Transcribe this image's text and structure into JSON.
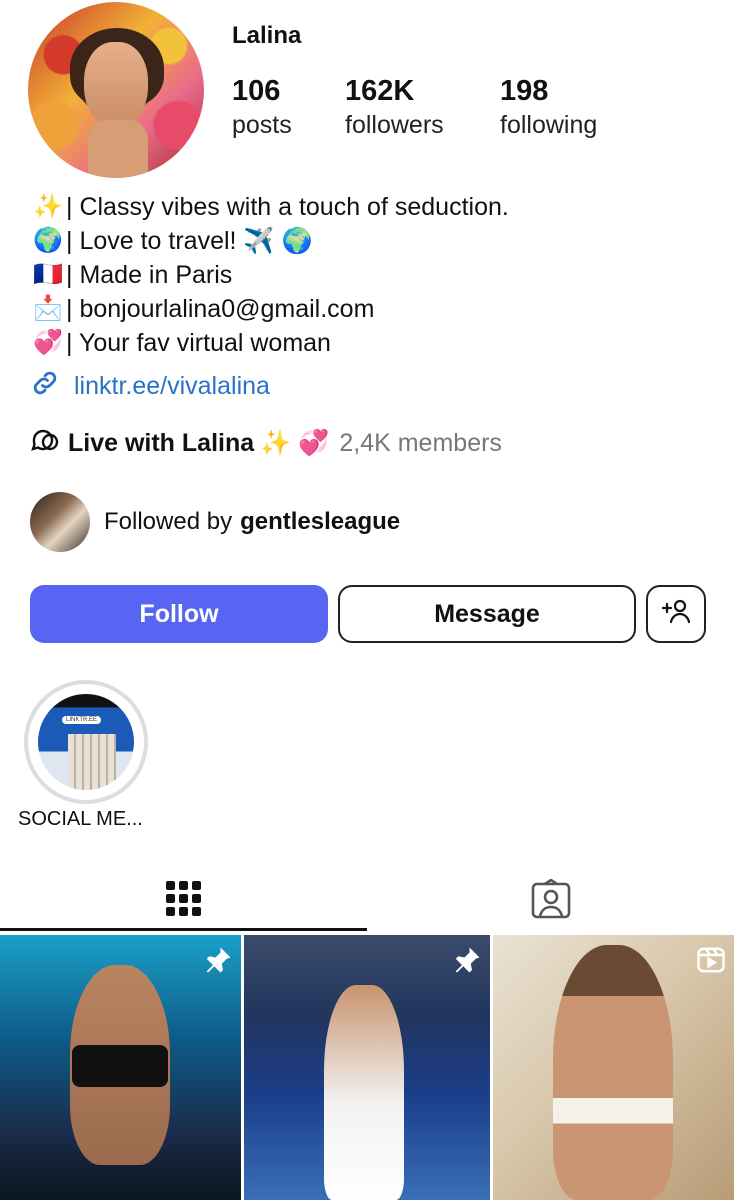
{
  "profile": {
    "username": "Lalina",
    "stats": [
      {
        "num": "106",
        "label": "posts"
      },
      {
        "num": "162K",
        "label": "followers"
      },
      {
        "num": "198",
        "label": "following"
      }
    ],
    "bio": [
      {
        "emoji": "✨",
        "text": "| Classy vibes with a touch of seduction."
      },
      {
        "emoji": "🌍",
        "text": "| Love to travel! ✈️ 🌍"
      },
      {
        "emoji": "🇫🇷",
        "text": "| Made in Paris"
      },
      {
        "emoji": "📩",
        "text": "| bonjourlalina0@gmail.com"
      },
      {
        "emoji": "💞",
        "text": "| Your fav virtual woman"
      }
    ],
    "link": "linktr.ee/vivalalina",
    "channel": {
      "name": "Live with Lalina",
      "emojis": "✨ 💞",
      "members": "2,4K members"
    },
    "followed_by": {
      "prefix": "Followed by",
      "user": "gentlesleague"
    }
  },
  "actions": {
    "follow": "Follow",
    "message": "Message"
  },
  "highlight": {
    "label": "SOCIAL ME...",
    "thumb_tag": "LINKTR.EE"
  },
  "icons": {
    "link": "link-icon",
    "channel": "chat-bubbles-icon",
    "add_user": "add-user-icon",
    "grid": "grid-icon",
    "tagged": "tagged-portrait-icon",
    "pin": "pin-icon",
    "reel": "reel-icon"
  },
  "colors": {
    "follow_button": "#5865f2",
    "link": "#2a72c9"
  }
}
